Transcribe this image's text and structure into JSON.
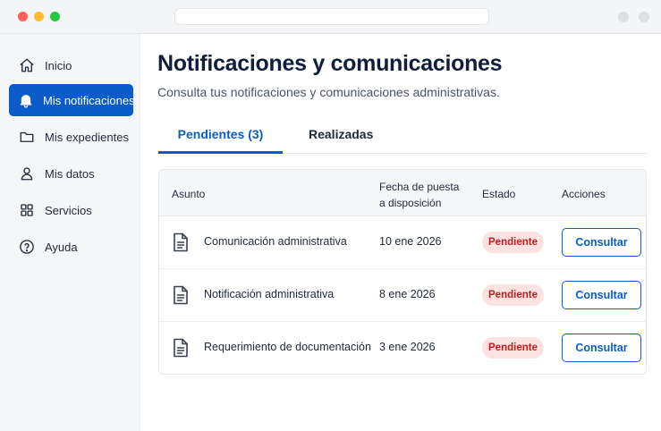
{
  "sidebar": {
    "items": [
      {
        "label": "Inicio",
        "icon": "home-icon"
      },
      {
        "label": "Mis notificaciones",
        "icon": "bell-icon",
        "active": true
      },
      {
        "label": "Mis expedientes",
        "icon": "folder-icon"
      },
      {
        "label": "Mis datos",
        "icon": "user-icon"
      },
      {
        "label": "Servicios",
        "icon": "grid-icon"
      },
      {
        "label": "Ayuda",
        "icon": "help-circle-icon"
      }
    ]
  },
  "main": {
    "title": "Notificaciones y comunicaciones",
    "subtitle": "Consulta tus notificaciones y comunicaciones administrativas.",
    "tabs": [
      {
        "label": "Pendientes (3)",
        "active": true
      },
      {
        "label": "Realizadas",
        "active": false
      }
    ],
    "table": {
      "headers": {
        "asunto": "Asunto",
        "fecha_line1": "Fecha de puesta",
        "fecha_line2": "a disposición",
        "estado": "Estado",
        "acciones": "Acciones"
      },
      "rows": [
        {
          "asunto": "Comunicación administrativa",
          "fecha": "10 ene 2026",
          "estado": "Pendiente",
          "accion": "Consultar"
        },
        {
          "asunto": "Notificación administrativa",
          "fecha": "8 ene 2026",
          "estado": "Pendiente",
          "accion": "Consultar"
        },
        {
          "asunto": "Requerimiento de documentación",
          "fecha": "3 ene 2026",
          "estado": "Pendiente",
          "accion": "Consultar"
        }
      ]
    }
  },
  "colors": {
    "accent": "#0b5cc8",
    "badge_bg": "#fde2e2",
    "badge_text": "#c21d1d",
    "title": "#0f1e3c"
  }
}
